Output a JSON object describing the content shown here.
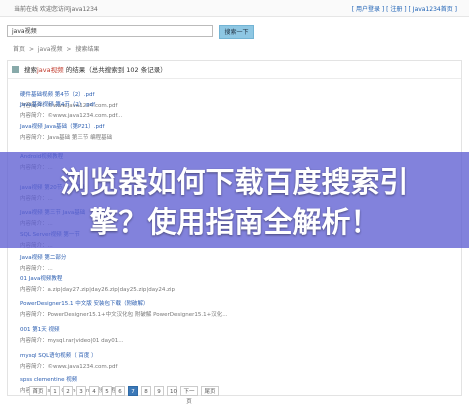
{
  "topbar": {
    "left_text": "当前在线  欢迎您访问java1234",
    "right_text": "[ 用户登录 ] [ 注册 ] [ Java1234首页 ]"
  },
  "search": {
    "value": "java视频",
    "button_label": "搜索一下"
  },
  "breadcrumb": {
    "home": "首页",
    "sep1": ">",
    "section": "java视频",
    "sep2": ">",
    "current": "搜索结果"
  },
  "results_header": {
    "prefix": "搜索",
    "keyword": "java视频",
    "suffix": " 的结果（总共搜索到 102 条记录）"
  },
  "results": [
    {
      "title": "硬件基础视频 第4节（2）.pdf",
      "desc": "内容简介：©www.java1234.com.pdf"
    },
    {
      "title": "Java基础视频 第4节（2）.pdf",
      "desc": "内容简介：©www.java1234.com.pdf..."
    },
    {
      "title": "Java视频 Java基础（第P21）.pdf",
      "desc": "内容简介：Java基础 第三节 编程基础"
    },
    {
      "title": "Android视频教程",
      "desc": "内容简介：..."
    },
    {
      "title": "java视频 第20节 Java基础",
      "desc": "内容简介：..."
    },
    {
      "title": "Java视频 第三节 Java基础",
      "desc": "内容简介：..."
    },
    {
      "title": "SQL Server视频 第一节",
      "desc": "内容简介：..."
    },
    {
      "title": "Java视频 第二部分",
      "desc": "内容简介：..."
    },
    {
      "title": "01  Java视频教程",
      "desc": "内容简介：a.zip|day27.zip|day26.zip|day25.zip|day24.zip"
    },
    {
      "title": "PowerDesigner15.1 中文版 安装包下载（附破解）",
      "desc": "内容简介：PowerDesigner15.1+中文汉化包 附破解 PowerDesigner15.1+汉化..."
    },
    {
      "title": "001 第1天 视频",
      "desc": "内容简介：mysql.rar|video|01 day01..."
    },
    {
      "title": "mysql SQL语句视频（ 百度 ）",
      "desc": "内容简介：©www.java1234.com.pdf"
    },
    {
      "title": "spss clementine 视频",
      "desc": "内容简介：spss Clementine 视频教程..."
    }
  ],
  "pagination": [
    "首页",
    "1",
    "2",
    "3",
    "4",
    "5",
    "6",
    "7",
    "8",
    "9",
    "10",
    "下一页",
    "尾页"
  ],
  "headline": {
    "line1": "浏览器如何下载百度搜索引",
    "line2": "擎？使用指南全解析！"
  },
  "colors": {
    "overlay": "#5f5fd2",
    "accent": "#3b78b8",
    "link": "#2a5db0"
  }
}
